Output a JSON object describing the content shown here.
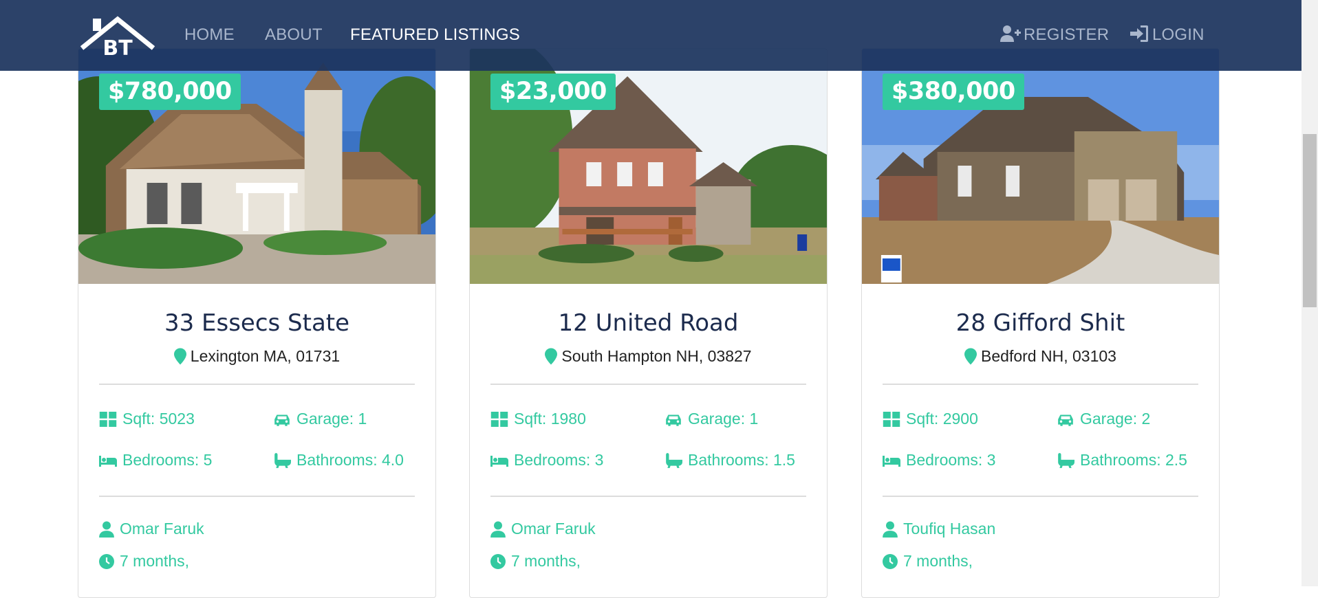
{
  "nav": {
    "links": [
      "HOME",
      "ABOUT",
      "FEATURED LISTINGS"
    ],
    "register": "REGISTER",
    "login": "LOGIN",
    "logo_text": "BT"
  },
  "colors": {
    "accent": "#33c9a0",
    "navbar": "#1c345e",
    "title": "#1c2b4d"
  },
  "listings": [
    {
      "price": "$780,000",
      "title": "33 Essecs State",
      "location": "Lexington MA, 01731",
      "sqft": "Sqft: 5023",
      "garage": "Garage: 1",
      "bedrooms": "Bedrooms: 5",
      "bathrooms": "Bathrooms: 4.0",
      "agent": "Omar Faruk",
      "time": "7 months,"
    },
    {
      "price": "$23,000",
      "title": "12 United Road",
      "location": "South Hampton NH, 03827",
      "sqft": "Sqft: 1980",
      "garage": "Garage: 1",
      "bedrooms": "Bedrooms: 3",
      "bathrooms": "Bathrooms: 1.5",
      "agent": "Omar Faruk",
      "time": "7 months,"
    },
    {
      "price": "$380,000",
      "title": "28 Gifford Shit",
      "location": "Bedford NH, 03103",
      "sqft": "Sqft: 2900",
      "garage": "Garage: 2",
      "bedrooms": "Bedrooms: 3",
      "bathrooms": "Bathrooms: 2.5",
      "agent": "Toufiq Hasan",
      "time": "7 months,"
    }
  ]
}
